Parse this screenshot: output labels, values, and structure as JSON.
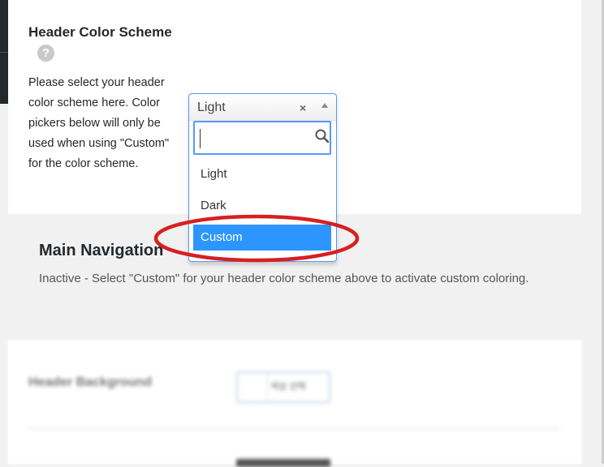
{
  "setting": {
    "title": "Header Color Scheme",
    "help": "?",
    "description": "Please select your header color scheme here. Color pickers below will only be used when using \"Custom\" for the color scheme."
  },
  "select": {
    "current_value": "Light",
    "clear_glyph": "×",
    "search_value": "",
    "options": [
      "Light",
      "Dark",
      "Custom"
    ],
    "highlighted": "Custom"
  },
  "main_navigation": {
    "title": "Main Navigation",
    "description": "Inactive - Select \"Custom\" for your header color scheme above to activate custom coloring."
  },
  "header_background": {
    "label": "Header Background",
    "button_label": "색상 선택"
  },
  "icons": {
    "help": "question-icon",
    "clear": "close-icon",
    "arrow": "chevron-up-icon",
    "search": "search-icon"
  },
  "colors": {
    "highlight": "#2d95ff",
    "focus_border": "#5897fb",
    "annotation": "#d62020"
  }
}
